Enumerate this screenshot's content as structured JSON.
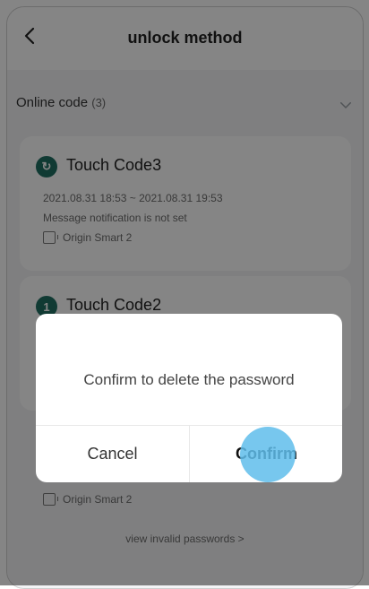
{
  "header": {
    "title": "unlock method"
  },
  "section": {
    "label": "Online code",
    "count": "(3)"
  },
  "codes": [
    {
      "name": "Touch Code3",
      "badge": "↻",
      "time_range": "2021.08.31 18:53 ~ 2021.08.31 19:53",
      "notification": "Message notification is not set",
      "device": "Origin Smart 2"
    },
    {
      "name": "Touch Code2",
      "badge": "1",
      "device": "Origin Smart 2"
    }
  ],
  "footer": {
    "invalid_link": "view invalid passwords >"
  },
  "dialog": {
    "message": "Confirm to delete the password",
    "cancel": "Cancel",
    "confirm": "Confirm"
  }
}
